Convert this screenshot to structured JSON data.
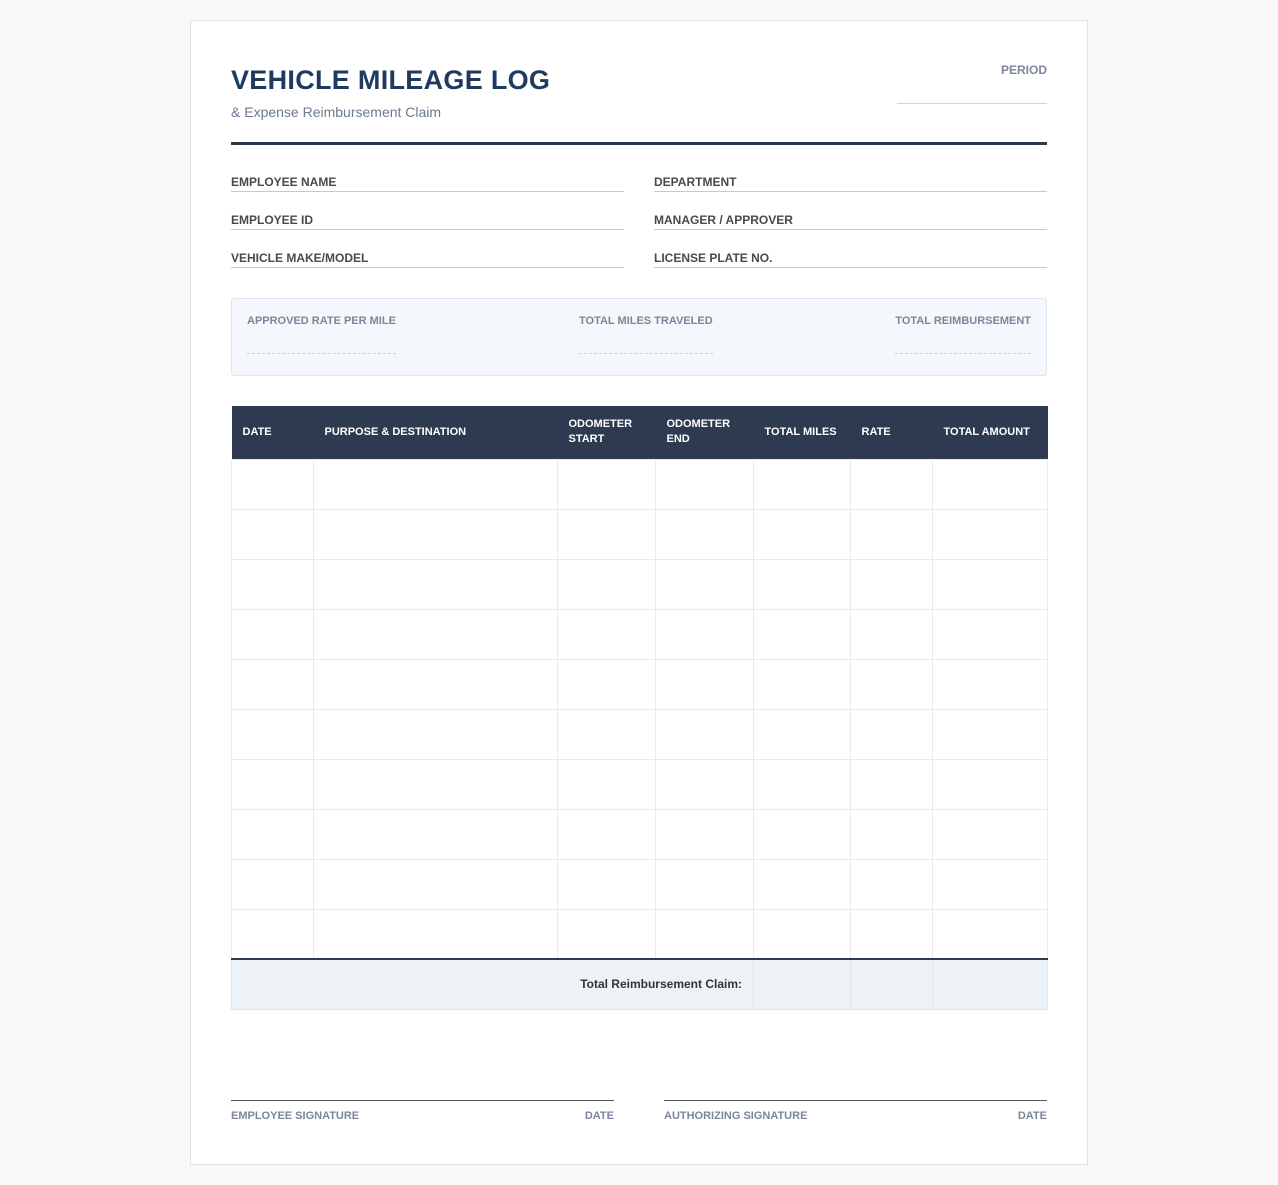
{
  "header": {
    "title": "VEHICLE MILEAGE LOG",
    "subtitle": "& Expense Reimbursement Claim",
    "period_label": "PERIOD"
  },
  "fields": {
    "employee_name": "EMPLOYEE NAME",
    "department": "DEPARTMENT",
    "employee_id": "EMPLOYEE ID",
    "manager": "MANAGER / APPROVER",
    "vehicle": "VEHICLE MAKE/MODEL",
    "license": "LICENSE PLATE NO."
  },
  "summary": {
    "rate": "APPROVED RATE PER MILE",
    "miles": "TOTAL MILES TRAVELED",
    "reimbursement": "TOTAL REIMBURSEMENT"
  },
  "table": {
    "headers": {
      "date": "DATE",
      "purpose": "PURPOSE & DESTINATION",
      "odo_start": "ODOMETER START",
      "odo_end": "ODOMETER END",
      "total_miles": "TOTAL MILES",
      "rate": "RATE",
      "total_amount": "TOTAL AMOUNT"
    },
    "total_label": "Total Reimbursement Claim:"
  },
  "signatures": {
    "employee": "EMPLOYEE SIGNATURE",
    "employee_date": "DATE",
    "authorizing": "AUTHORIZING SIGNATURE",
    "authorizing_date": "DATE"
  }
}
